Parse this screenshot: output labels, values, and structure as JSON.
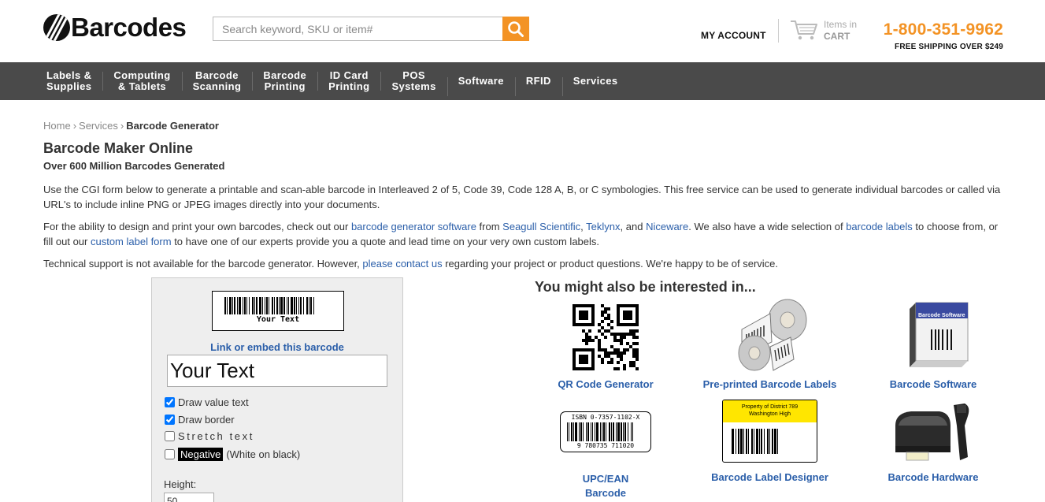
{
  "header": {
    "logo_text": "Barcodes",
    "search_placeholder": "Search keyword, SKU or item#",
    "my_account": "MY ACCOUNT",
    "cart_line1": "Items in",
    "cart_line2": "CART",
    "phone": "1-800-351-9962",
    "shipping": "FREE SHIPPING OVER $249",
    "accent_color": "#f39325"
  },
  "nav": {
    "items": [
      {
        "line1": "Labels &",
        "line2": "Supplies"
      },
      {
        "line1": "Computing",
        "line2": "& Tablets"
      },
      {
        "line1": "Barcode",
        "line2": "Scanning"
      },
      {
        "line1": "Barcode",
        "line2": "Printing"
      },
      {
        "line1": "ID Card",
        "line2": "Printing"
      },
      {
        "line1": "POS",
        "line2": "Systems"
      },
      {
        "line1": "Software",
        "line2": ""
      },
      {
        "line1": "RFID",
        "line2": ""
      },
      {
        "line1": "Services",
        "line2": ""
      }
    ]
  },
  "breadcrumb": {
    "home": "Home",
    "services": "Services",
    "current": "Barcode Generator",
    "separator": "›"
  },
  "main": {
    "title": "Barcode Maker Online",
    "subtitle": "Over 600 Million Barcodes Generated",
    "p1": "Use the CGI form below to generate a printable and scan-able barcode in Interleaved 2 of 5, Code 39, Code 128 A, B, or C symbologies. This free service can be used to generate individual barcodes or called via URL's to include inline PNG or JPEG images directly into your documents.",
    "p2": {
      "t1": "For the ability to design and print your own barcodes, check out our ",
      "l1": "barcode generator software",
      "t2": " from ",
      "l2": "Seagull Scientific",
      "t3": ", ",
      "l3": "Teklynx",
      "t4": ", and ",
      "l4": "Niceware",
      "t5": ". We also have a wide selection of ",
      "l5": "barcode labels",
      "t6": " to choose from, or fill out our ",
      "l6": "custom label form",
      "t7": " to have one of our experts provide you a quote and lead time on your very own custom labels."
    },
    "p3": {
      "t1": "Technical support is not available for the barcode generator. However, ",
      "l1": "please contact us",
      "t2": " regarding your project or product questions. We're happy to be of service."
    }
  },
  "generator": {
    "preview_text": "Your Text",
    "embed_link": "Link or embed this barcode",
    "input_value": "Your Text",
    "opt_draw_value": "Draw value text",
    "opt_draw_border": "Draw border",
    "opt_stretch": "Stretch text",
    "opt_negative_badge": "Negative",
    "opt_negative_rest": "(White on black)",
    "height_label": "Height:",
    "height_value": "50"
  },
  "related": {
    "title": "You might also be interested in...",
    "tiles": [
      {
        "label": "QR Code Generator"
      },
      {
        "label": "Pre-printed Barcode Labels"
      },
      {
        "label": "Barcode Software"
      },
      {
        "label": "UPC/EAN Barcode Generator"
      },
      {
        "label": "Barcode Label Designer"
      },
      {
        "label": "Barcode Hardware"
      }
    ],
    "software_box_text": "Barcode Software",
    "upc_top_text": "ISBN 0-7357-1102-X",
    "upc_bottom_text": "9 780735 711020",
    "designer_line1": "Property of District 789",
    "designer_line2": "Washington High"
  }
}
